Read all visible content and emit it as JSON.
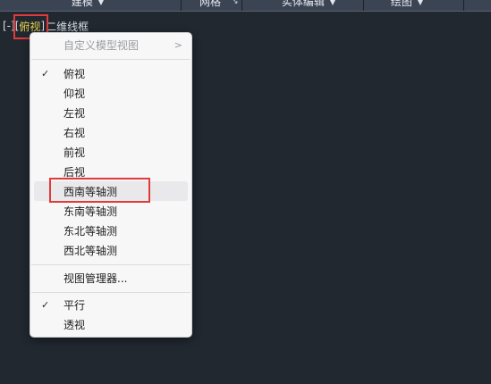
{
  "ribbon": {
    "tabs": [
      {
        "label": "建模",
        "has_dropdown": true
      },
      {
        "label": "网格",
        "has_dropdown": false
      },
      {
        "label": "实体编辑",
        "has_dropdown": true
      },
      {
        "label": "绘图",
        "has_dropdown": true
      }
    ],
    "corner_glyph": "↘"
  },
  "viewport_label": {
    "prefix": "[-]",
    "open_bracket": "[",
    "active_view": "俯视",
    "close_bracket": "]",
    "view_mode": "二维线框"
  },
  "menu": {
    "custom_views": "自定义模型视图",
    "views": [
      {
        "label": "俯视",
        "checked": true
      },
      {
        "label": "仰视",
        "checked": false
      },
      {
        "label": "左视",
        "checked": false
      },
      {
        "label": "右视",
        "checked": false
      },
      {
        "label": "前视",
        "checked": false
      },
      {
        "label": "后视",
        "checked": false
      },
      {
        "label": "西南等轴测",
        "checked": false
      },
      {
        "label": "东南等轴测",
        "checked": false
      },
      {
        "label": "东北等轴测",
        "checked": false
      },
      {
        "label": "西北等轴测",
        "checked": false
      }
    ],
    "view_manager": "视图管理器...",
    "projections": [
      {
        "label": "平行",
        "checked": true
      },
      {
        "label": "透视",
        "checked": false
      }
    ]
  },
  "colors": {
    "highlight": "#e03a3a",
    "active_view_text": "#e8d34a",
    "viewport_bg": "#212830"
  }
}
